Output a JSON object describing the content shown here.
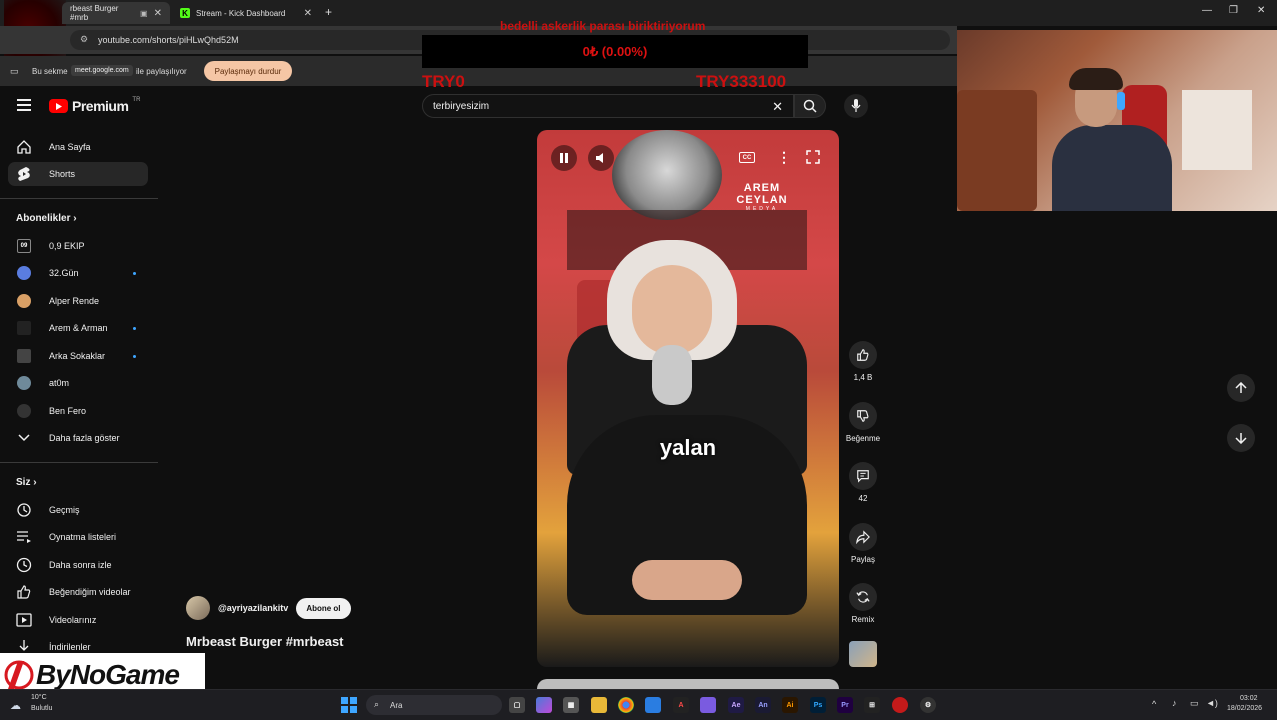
{
  "browser": {
    "tabs": [
      {
        "title": "rbeast Burger #mrb"
      },
      {
        "title": "Stream - Kick Dashboard"
      }
    ],
    "url": "youtube.com/shorts/piHLwQhd52M",
    "share_notice_prefix": "Bu sekme",
    "share_domain": "meet.google.com",
    "share_notice_suffix": "ile paylaşılıyor",
    "stop_share_label": "Paylaşmayı durdur"
  },
  "stream_overlay": {
    "donation_title": "bedelli askerlik parası biriktiriyorum",
    "donation_amount": "0₺ (0.00%)",
    "goal_left": "TRY0",
    "goal_right": "TRY333100"
  },
  "youtube": {
    "brand": "Premium",
    "brand_region": "TR",
    "search_query": "terbiryesizim",
    "nav": [
      {
        "label": "Ana Sayfa",
        "icon": "home-icon"
      },
      {
        "label": "Shorts",
        "icon": "shorts-icon"
      }
    ],
    "subs_heading": "Abonelikler",
    "subscriptions": [
      {
        "label": "0,9 EKIP",
        "avatar": "09"
      },
      {
        "label": "32.Gün",
        "new": true
      },
      {
        "label": "Alper Rende"
      },
      {
        "label": "Arem & Arman",
        "new": true
      },
      {
        "label": "Arka Sokaklar",
        "new": true
      },
      {
        "label": "at0m"
      },
      {
        "label": "Ben Fero"
      }
    ],
    "show_more": "Daha fazla göster",
    "you_heading": "Siz",
    "you_items": [
      {
        "label": "Geçmiş",
        "icon": "history-icon"
      },
      {
        "label": "Oynatma listeleri",
        "icon": "playlist-icon"
      },
      {
        "label": "Daha sonra izle",
        "icon": "clock-icon"
      },
      {
        "label": "Beğendiğim videolar",
        "icon": "like-icon"
      },
      {
        "label": "Videolarınız",
        "icon": "video-icon"
      },
      {
        "label": "İndirilenler",
        "icon": "download-icon"
      }
    ],
    "short": {
      "watermark_brand": "AREM CEYLAN",
      "watermark_sub": "MEDYA",
      "caption": "yalan",
      "channel": "@ayriyazilankitv",
      "subscribe_label": "Abone ol",
      "title": "Mrbeast Burger #mrbeast",
      "likes": "1,4 B",
      "dislike_label": "Beğenme",
      "comments": "42",
      "share_label": "Paylaş",
      "remix_label": "Remix"
    }
  },
  "logo_overlay": "ByNoGame",
  "taskbar": {
    "weather_temp": "10°C",
    "weather_desc": "Bulutlu",
    "search_placeholder": "Ara",
    "time": "03:02",
    "date": "18/02/2026"
  }
}
